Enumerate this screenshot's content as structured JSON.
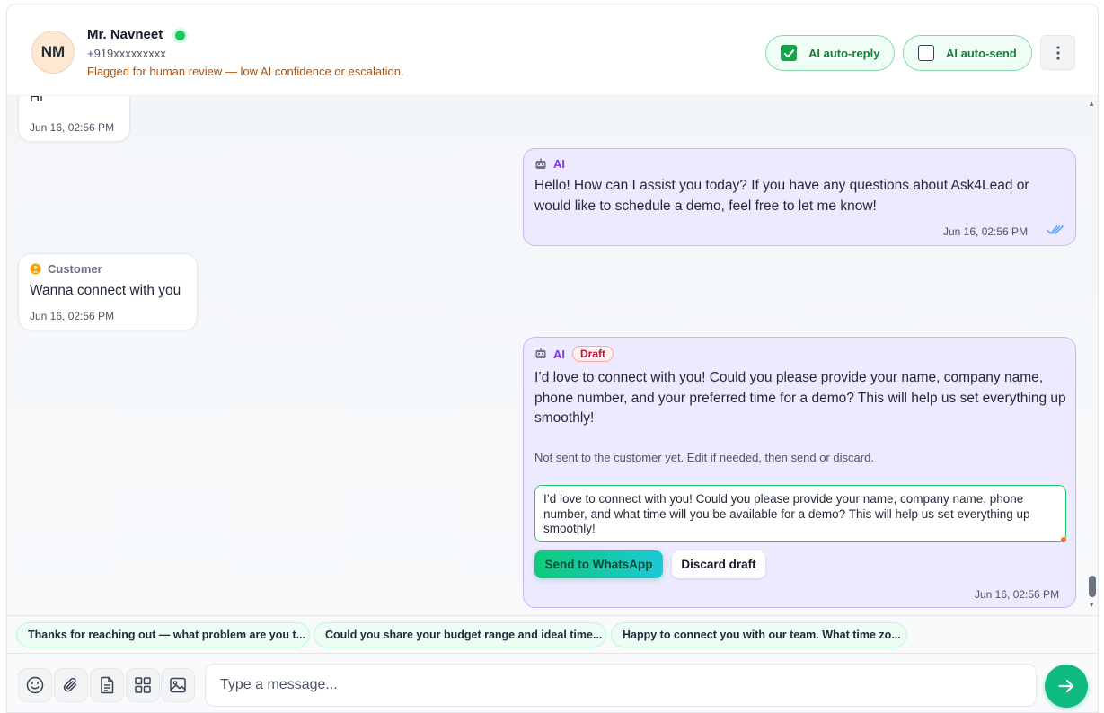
{
  "header": {
    "avatar_initials": "NM",
    "contact_name": "Mr. Navneet",
    "phone": "+919xxxxxxxxx",
    "flag_text": "Flagged for human review — low AI confidence or escalation.",
    "ai_auto_reply_label": "AI auto-reply",
    "ai_auto_reply_checked": true,
    "ai_auto_send_label": "AI auto-send",
    "ai_auto_send_checked": false,
    "more_icon": "more-vertical-icon"
  },
  "messages": [
    {
      "direction": "incoming",
      "text": "Hi",
      "time": "Jun 16, 02:56 PM"
    },
    {
      "direction": "outgoing",
      "sender": "AI",
      "text": "Hello! How can I assist you today? If you have any questions about Ask4Lead or would like to schedule a demo, feel free to let me know!",
      "time": "Jun 16, 02:56 PM",
      "status_icon": "double-check-icon"
    },
    {
      "direction": "incoming",
      "sender": "Customer",
      "text": "Wanna connect with you",
      "time": "Jun 16, 02:56 PM"
    },
    {
      "direction": "outgoing",
      "sender": "AI",
      "badge": "Draft",
      "text": "I’d love to connect with you! Could you please provide your name, company name, phone number, and your preferred time for a demo? This will help us set everything up smoothly!",
      "note": "Not sent to the customer yet. Edit if needed, then send or discard.",
      "editor_value": "I’d love to connect with you! Could you please provide your name, company name, phone number, and what time will you be available for a demo? This will help us set everything up smoothly!",
      "send_label": "Send to WhatsApp",
      "discard_label": "Discard draft",
      "time": "Jun 16, 02:56 PM"
    }
  ],
  "suggestions": [
    "Thanks for reaching out — what problem are you t...",
    "Could you share your budget range and ideal time...",
    "Happy to connect you with our team. What time zo..."
  ],
  "composer": {
    "placeholder": "Type a message...",
    "tools": [
      "emoji-icon",
      "paperclip-icon",
      "document-icon",
      "grid-icon",
      "image-icon"
    ],
    "send_icon": "send-icon"
  },
  "colors": {
    "brand_green": "#10b981",
    "ai_bubble": "#ede9fe",
    "ai_accent": "#7c3aed",
    "flag": "#b45309"
  }
}
